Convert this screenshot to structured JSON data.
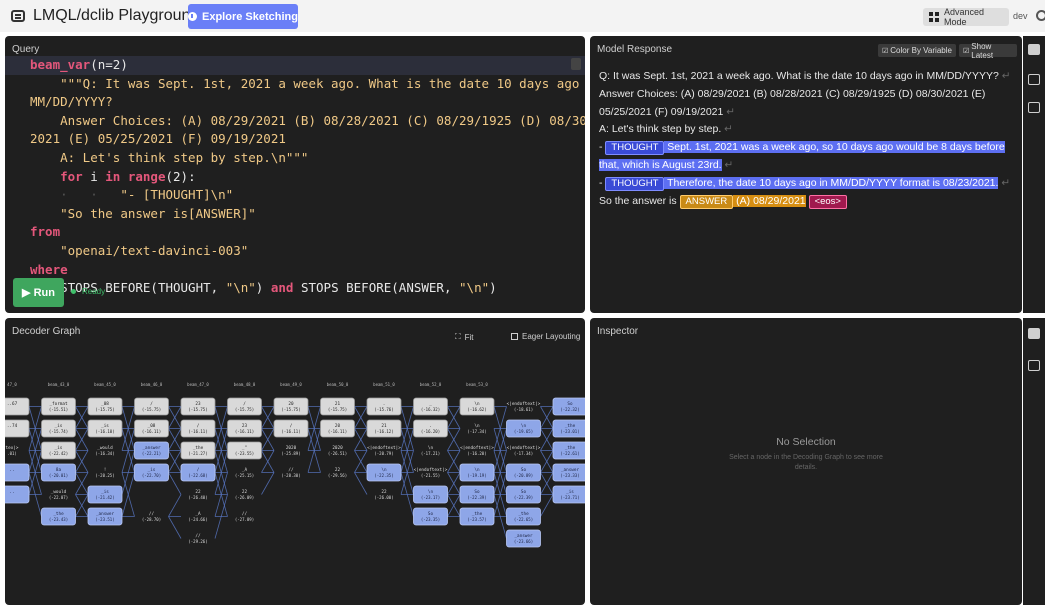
{
  "header": {
    "app_title": "LMQL/dclib Playground",
    "explore_label": "Explore Sketching",
    "advanced_label": "Advanced Mode",
    "dev_label": "dev"
  },
  "query": {
    "title": "Query",
    "lines": [
      [
        [
          "kw",
          "beam_var"
        ],
        [
          "plain",
          "(n=2)"
        ]
      ],
      [
        [
          "ind",
          "    "
        ],
        [
          "strc",
          "\"\"\"Q: It was Sept. 1st, 2021 a week ago. What is the date 10 days ago in"
        ]
      ],
      [
        [
          "strc",
          "MM/DD/YYYY?"
        ]
      ],
      [
        [
          "ind",
          "    "
        ],
        [
          "strc",
          "Answer Choices: (A) 08/29/2021 (B) 08/28/2021 (C) 08/29/1925 (D) 08/30/"
        ]
      ],
      [
        [
          "strc",
          "2021 (E) 05/25/2021 (F) 09/19/2021"
        ]
      ],
      [
        [
          "ind",
          "    "
        ],
        [
          "strc",
          "A: Let's think step by step.\\n\"\"\""
        ]
      ],
      [
        [
          "ind",
          "    "
        ],
        [
          "kw",
          "for"
        ],
        [
          "plain",
          " i "
        ],
        [
          "kw",
          "in"
        ],
        [
          "plain",
          " "
        ],
        [
          "kw",
          "range"
        ],
        [
          "plain",
          "(2):"
        ]
      ],
      [
        [
          "ind",
          "    ·   ·   "
        ],
        [
          "strc",
          "\"- [THOUGHT]\\n\""
        ]
      ],
      [
        [
          "ind",
          "    "
        ],
        [
          "strc",
          "\"So the answer is[ANSWER]\""
        ]
      ],
      [
        [
          "kw",
          "from"
        ]
      ],
      [
        [
          "ind",
          "    "
        ],
        [
          "strc",
          "\"openai/text-davinci-003\""
        ]
      ],
      [
        [
          "kw",
          "where"
        ]
      ],
      [
        [
          "ind",
          "    "
        ],
        [
          "plain",
          "STOPS BEFORE(THOUGHT, "
        ],
        [
          "strc",
          "\"\\n\""
        ],
        [
          "plain",
          ") "
        ],
        [
          "kw",
          "and"
        ],
        [
          "plain",
          " STOPS BEFORE(ANSWER, "
        ],
        [
          "strc",
          "\"\\n\""
        ],
        [
          "plain",
          ")"
        ]
      ]
    ],
    "run_label": "▶ Run",
    "status_label": "Ready"
  },
  "response": {
    "title": "Model Response",
    "color_by_label": "Color By Variable",
    "show_latest_label": "Show Latest",
    "q_line": "Q: It was Sept. 1st, 2021 a week ago. What is the date 10 days ago in MM/DD/YYYY?",
    "choices": "Answer Choices: (A) 08/29/2021 (B) 08/28/2021 (C) 08/29/1925 (D) 08/30/2021 (E) 05/25/2021 (F) 09/19/2021",
    "a_line": "A: Let's think step by step.",
    "dash": "-",
    "thought_tag": "THOUGHT",
    "thought1_text": " Sept. 1st, 2021 was a week ago, so 10 days ago would be 8 days before that, which is August 23rd.",
    "thought2_text": " Therefore, the date 10 days ago in MM/DD/YYYY format is 08/23/2021.",
    "answer_prefix": "So the answer is ",
    "answer_tag": "ANSWER",
    "answer_text": " (A) 08/29/2021",
    "eos_tag": "<eos>",
    "return_glyph": "↵"
  },
  "decoder": {
    "title": "Decoder Graph",
    "fit_label": "Fit",
    "eager_label": "Eager Layouting",
    "headers": [
      "47_0",
      "beam_43_0",
      "beam_45_0",
      "beam_46_0",
      "beam_47_0",
      "beam_48_0",
      "beam_49_0",
      "beam_50_0",
      "beam_51_0",
      "beam_52_0",
      "beam_53_0"
    ],
    "nodes": [
      {
        "t": "..67",
        "s": "",
        "c": 0,
        "r": 0,
        "k": "gray"
      },
      {
        "t": "..74",
        "s": "",
        "c": 0,
        "r": 1,
        "k": "gray"
      },
      {
        "t": "tex|>",
        "s": ".01)",
        "c": 0,
        "r": 2,
        "k": "plain"
      },
      {
        "t": "..",
        "s": "",
        "c": 0,
        "r": 3,
        "k": "blue"
      },
      {
        "t": "..",
        "s": "",
        "c": 0,
        "r": 4,
        "k": "blue"
      },
      {
        "t": "_format",
        "s": "(-15.51)",
        "c": 1,
        "r": 0,
        "k": "gray"
      },
      {
        "t": "_is",
        "s": "(-15.74)",
        "c": 1,
        "r": 1,
        "k": "gray"
      },
      {
        "t": "_is",
        "s": "(-22.42)",
        "c": 1,
        "r": 2,
        "k": "gray"
      },
      {
        "t": "8a",
        "s": "(-20.01)",
        "c": 1,
        "r": 3,
        "k": "blue"
      },
      {
        "t": "_would",
        "s": "(-22.07)",
        "c": 1,
        "r": 4,
        "k": "plain"
      },
      {
        "t": "_the",
        "s": "(-23.43)",
        "c": 1,
        "r": 5,
        "k": "blue"
      },
      {
        "t": "_08",
        "s": "(-15.75)",
        "c": 2,
        "r": 0,
        "k": "gray"
      },
      {
        "t": "_is",
        "s": "(-16.10)",
        "c": 2,
        "r": 1,
        "k": "gray"
      },
      {
        "t": "_would",
        "s": "(-16.34)",
        "c": 2,
        "r": 2,
        "k": "plain"
      },
      {
        "t": "!",
        "s": "(-20.25)",
        "c": 2,
        "r": 3,
        "k": "plain"
      },
      {
        "t": "_is",
        "s": "(-21.42)",
        "c": 2,
        "r": 4,
        "k": "blue"
      },
      {
        "t": "_answer",
        "s": "(-23.51)",
        "c": 2,
        "r": 5,
        "k": "blue"
      },
      {
        "t": "/",
        "s": "(-15.75)",
        "c": 3,
        "r": 0,
        "k": "gray"
      },
      {
        "t": "_08",
        "s": "(-16.11)",
        "c": 3,
        "r": 1,
        "k": "gray"
      },
      {
        "t": "_answer",
        "s": "(-22.21)",
        "c": 3,
        "r": 2,
        "k": "blue"
      },
      {
        "t": "_is",
        "s": "(-22.70)",
        "c": 3,
        "r": 3,
        "k": "blue"
      },
      {
        "t": "//",
        "s": "(-28.70)",
        "c": 3,
        "r": 5,
        "k": "plain"
      },
      {
        "t": "23",
        "s": "(-15.75)",
        "c": 4,
        "r": 0,
        "k": "gray"
      },
      {
        "t": "/",
        "s": "(-16.11)",
        "c": 4,
        "r": 1,
        "k": "gray"
      },
      {
        "t": "_the",
        "s": "(-21.27)",
        "c": 4,
        "r": 2,
        "k": "gray"
      },
      {
        "t": "/",
        "s": "(-22.68)",
        "c": 4,
        "r": 3,
        "k": "blue"
      },
      {
        "t": "22",
        "s": "(-26.40)",
        "c": 4,
        "r": 4,
        "k": "plain"
      },
      {
        "t": "_A",
        "s": "(-24.66)",
        "c": 4,
        "r": 5,
        "k": "plain"
      },
      {
        "t": "//",
        "s": "(-29.26)",
        "c": 4,
        "r": 6,
        "k": "plain"
      },
      {
        "t": "/",
        "s": "(-15.75)",
        "c": 5,
        "r": 0,
        "k": "gray"
      },
      {
        "t": "23",
        "s": "(-16.11)",
        "c": 5,
        "r": 1,
        "k": "gray"
      },
      {
        "t": "_\"",
        "s": "(-23.55)",
        "c": 5,
        "r": 2,
        "k": "gray"
      },
      {
        "t": "_A",
        "s": "(-25.15)",
        "c": 5,
        "r": 3,
        "k": "plain"
      },
      {
        "t": "22",
        "s": "(-26.09)",
        "c": 5,
        "r": 4,
        "k": "plain"
      },
      {
        "t": "//",
        "s": "(-27.89)",
        "c": 5,
        "r": 5,
        "k": "plain"
      },
      {
        "t": "20",
        "s": "(-15.75)",
        "c": 6,
        "r": 0,
        "k": "gray"
      },
      {
        "t": "/",
        "s": "(-16.11)",
        "c": 6,
        "r": 1,
        "k": "gray"
      },
      {
        "t": "2020",
        "s": "(-25.89)",
        "c": 6,
        "r": 2,
        "k": "plain"
      },
      {
        "t": "//",
        "s": "(-28.30)",
        "c": 6,
        "r": 3,
        "k": "plain"
      },
      {
        "t": "21",
        "s": "(-15.75)",
        "c": 7,
        "r": 0,
        "k": "gray"
      },
      {
        "t": "20",
        "s": "(-16.11)",
        "c": 7,
        "r": 1,
        "k": "gray"
      },
      {
        "t": "2020",
        "s": "(-26.51)",
        "c": 7,
        "r": 2,
        "k": "plain"
      },
      {
        "t": "22",
        "s": "(-29.56)",
        "c": 7,
        "r": 3,
        "k": "plain"
      },
      {
        "t": ".",
        "s": "(-15.76)",
        "c": 8,
        "r": 0,
        "k": "gray"
      },
      {
        "t": "21",
        "s": "(-16.12)",
        "c": 8,
        "r": 1,
        "k": "gray"
      },
      {
        "t": "<|endoftext|>",
        "s": "(-20.79)",
        "c": 8,
        "r": 2,
        "k": "plain"
      },
      {
        "t": "\\n",
        "s": "(-22.35)",
        "c": 8,
        "r": 3,
        "k": "blue"
      },
      {
        "t": "22",
        "s": "(-26.00)",
        "c": 8,
        "r": 4,
        "k": "plain"
      },
      {
        "t": "_",
        "s": "(-16.32)",
        "c": 9,
        "r": 0,
        "k": "gray"
      },
      {
        "t": ".",
        "s": "(-16.20)",
        "c": 9,
        "r": 1,
        "k": "gray"
      },
      {
        "t": "\\n",
        "s": "(-17.21)",
        "c": 9,
        "r": 2,
        "k": "plain"
      },
      {
        "t": "<|endoftext|>",
        "s": "(-21.55)",
        "c": 9,
        "r": 3,
        "k": "plain"
      },
      {
        "t": "\\n",
        "s": "(-23.17)",
        "c": 9,
        "r": 4,
        "k": "blue"
      },
      {
        "t": "So",
        "s": "(-23.35)",
        "c": 9,
        "r": 5,
        "k": "blue"
      },
      {
        "t": "\\n",
        "s": "(-16.62)",
        "c": 10,
        "r": 0,
        "k": "gray"
      },
      {
        "t": "\\n",
        "s": "(-17.34)",
        "c": 10,
        "r": 1,
        "k": "plain"
      },
      {
        "t": "<|endoftext|>",
        "s": "(-16.20)",
        "c": 10,
        "r": 2,
        "k": "plain"
      },
      {
        "t": "\\n",
        "s": "(-19.19)",
        "c": 10,
        "r": 3,
        "k": "blue"
      },
      {
        "t": "So",
        "s": "(-22.39)",
        "c": 10,
        "r": 4,
        "k": "blue"
      },
      {
        "t": "_the",
        "s": "(-23.57)",
        "c": 10,
        "r": 5,
        "k": "blue"
      },
      {
        "t": "<|endoftext|>",
        "s": "(-18.61)",
        "c": 11,
        "r": 0,
        "k": "plain"
      },
      {
        "t": "\\n",
        "s": "(-19.65)",
        "c": 11,
        "r": 1,
        "k": "blue"
      },
      {
        "t": "<|endoftext|>",
        "s": "(-17.34)",
        "c": 11,
        "r": 2,
        "k": "plain"
      },
      {
        "t": "So",
        "s": "(-20.89)",
        "c": 11,
        "r": 3,
        "k": "blue"
      },
      {
        "t": "So",
        "s": "(-22.39)",
        "c": 11,
        "r": 4,
        "k": "blue"
      },
      {
        "t": "_the",
        "s": "(-22.65)",
        "c": 11,
        "r": 5,
        "k": "blue"
      },
      {
        "t": "_answer",
        "s": "(-23.66)",
        "c": 11,
        "r": 6,
        "k": "blue"
      },
      {
        "t": "So",
        "s": "(-22.32)",
        "c": 12,
        "r": 0,
        "k": "blue"
      },
      {
        "t": "_the",
        "s": "(-23.01)",
        "c": 12,
        "r": 1,
        "k": "blue"
      },
      {
        "t": "_the",
        "s": "(-22.61)",
        "c": 12,
        "r": 2,
        "k": "blue"
      },
      {
        "t": "_answer",
        "s": "(-23.33)",
        "c": 12,
        "r": 3,
        "k": "blue"
      },
      {
        "t": "_is",
        "s": "(-23.71)",
        "c": 12,
        "r": 4,
        "k": "blue"
      }
    ]
  },
  "inspector": {
    "title": "Inspector",
    "empty_title": "No Selection",
    "empty_sub": "Select a node in the Decoding Graph to see more details."
  }
}
